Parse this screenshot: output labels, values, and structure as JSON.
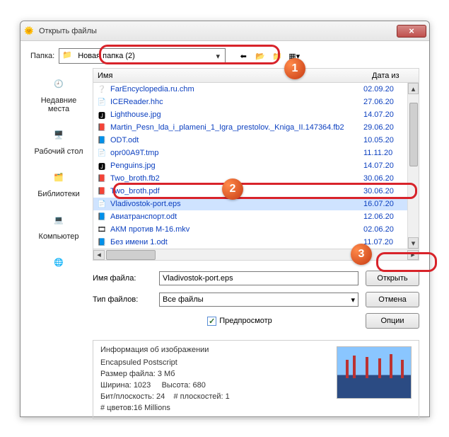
{
  "window": {
    "title": "Открыть файлы"
  },
  "folder": {
    "label": "Папка:",
    "current": "Новая папка (2)"
  },
  "columns": {
    "name": "Имя",
    "date": "Дата из"
  },
  "places": [
    {
      "label": "Недавние места"
    },
    {
      "label": "Рабочий стол"
    },
    {
      "label": "Библиотеки"
    },
    {
      "label": "Компьютер"
    },
    {
      "label": ""
    }
  ],
  "files": [
    {
      "icon": "chm",
      "name": "FarEncyclopedia.ru.chm",
      "date": "02.09.20"
    },
    {
      "icon": "hhc",
      "name": "ICEReader.hhc",
      "date": "27.06.20"
    },
    {
      "icon": "jpg",
      "name": "Lighthouse.jpg",
      "date": "14.07.20"
    },
    {
      "icon": "fb2",
      "name": "Martin_Pesn_lda_i_plameni_1_Igra_prestolov._Kniga_II.147364.fb2",
      "date": "29.06.20"
    },
    {
      "icon": "odt",
      "name": "ODT.odt",
      "date": "10.05.20"
    },
    {
      "icon": "tmp",
      "name": "opr00A9T.tmp",
      "date": "11.11.20"
    },
    {
      "icon": "jpg",
      "name": "Penguins.jpg",
      "date": "14.07.20"
    },
    {
      "icon": "fb2",
      "name": "Two_broth.fb2",
      "date": "30.06.20"
    },
    {
      "icon": "pdf",
      "name": "Two_broth.pdf",
      "date": "30.06.20"
    },
    {
      "icon": "eps",
      "name": "Vladivostok-port.eps",
      "date": "16.07.20",
      "selected": true
    },
    {
      "icon": "odt",
      "name": "Авиатранспорт.odt",
      "date": "12.06.20"
    },
    {
      "icon": "mkv",
      "name": "АКМ против М-16.mkv",
      "date": "02.06.20"
    },
    {
      "icon": "odt",
      "name": "Без имени 1.odt",
      "date": "11.07.20"
    }
  ],
  "form": {
    "filename_label": "Имя файла:",
    "filename_value": "Vladivostok-port.eps",
    "filetype_label": "Тип файлов:",
    "filetype_value": "Все файлы",
    "open": "Открыть",
    "cancel": "Отмена",
    "options": "Опции",
    "preview": "Предпросмотр"
  },
  "info": {
    "title": "Информация об изображении",
    "l1": "Encapsuled Postscript",
    "l2a": "Размер файла:",
    "l2b": "3 Мб",
    "l3a": "Ширина:",
    "l3b": "1023",
    "l3c": "Высота:",
    "l3d": "680",
    "l4a": "Бит/плоскость:",
    "l4b": "24",
    "l4c": "# плоскостей:",
    "l4d": "1",
    "l5a": "# цветов:",
    "l5b": "16 Millions"
  },
  "callouts": {
    "1": "1",
    "2": "2",
    "3": "3"
  }
}
